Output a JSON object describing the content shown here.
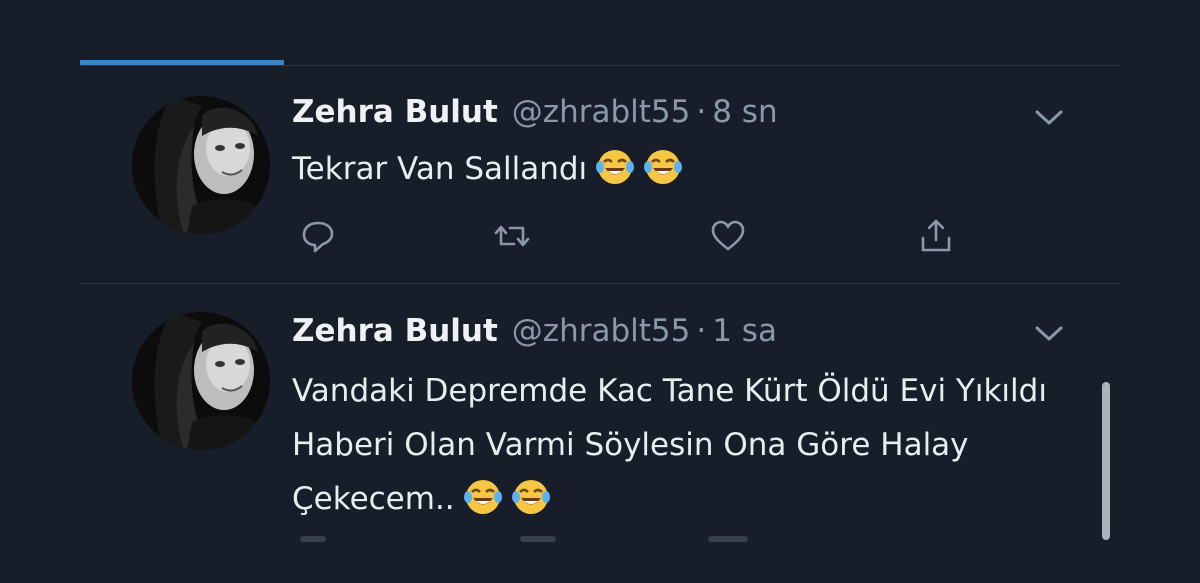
{
  "timeline": {
    "tweets": [
      {
        "display_name": "Zehra Bulut",
        "handle": "@zhrablt55",
        "separator": "·",
        "time": "8 sn",
        "text": "Tekrar Van Sallandı",
        "emojis": [
          "face-with-tears-of-joy",
          "face-with-tears-of-joy"
        ]
      },
      {
        "display_name": "Zehra Bulut",
        "handle": "@zhrablt55",
        "separator": "·",
        "time": "1 sa",
        "text": "Vandaki Depremde Kac Tane Kürt Öldü Evi Yıkıldı Haberi Olan Varmi Söylesin Ona Göre Halay Çekecem..",
        "emojis": [
          "face-with-tears-of-joy",
          "face-with-tears-of-joy"
        ]
      }
    ],
    "action_icons": [
      "reply-icon",
      "retweet-icon",
      "like-icon",
      "share-icon"
    ]
  },
  "colors": {
    "background": "#171e29",
    "accent": "#3f86c7",
    "secondary_text": "#8b98a5",
    "divider": "#2b3440"
  }
}
